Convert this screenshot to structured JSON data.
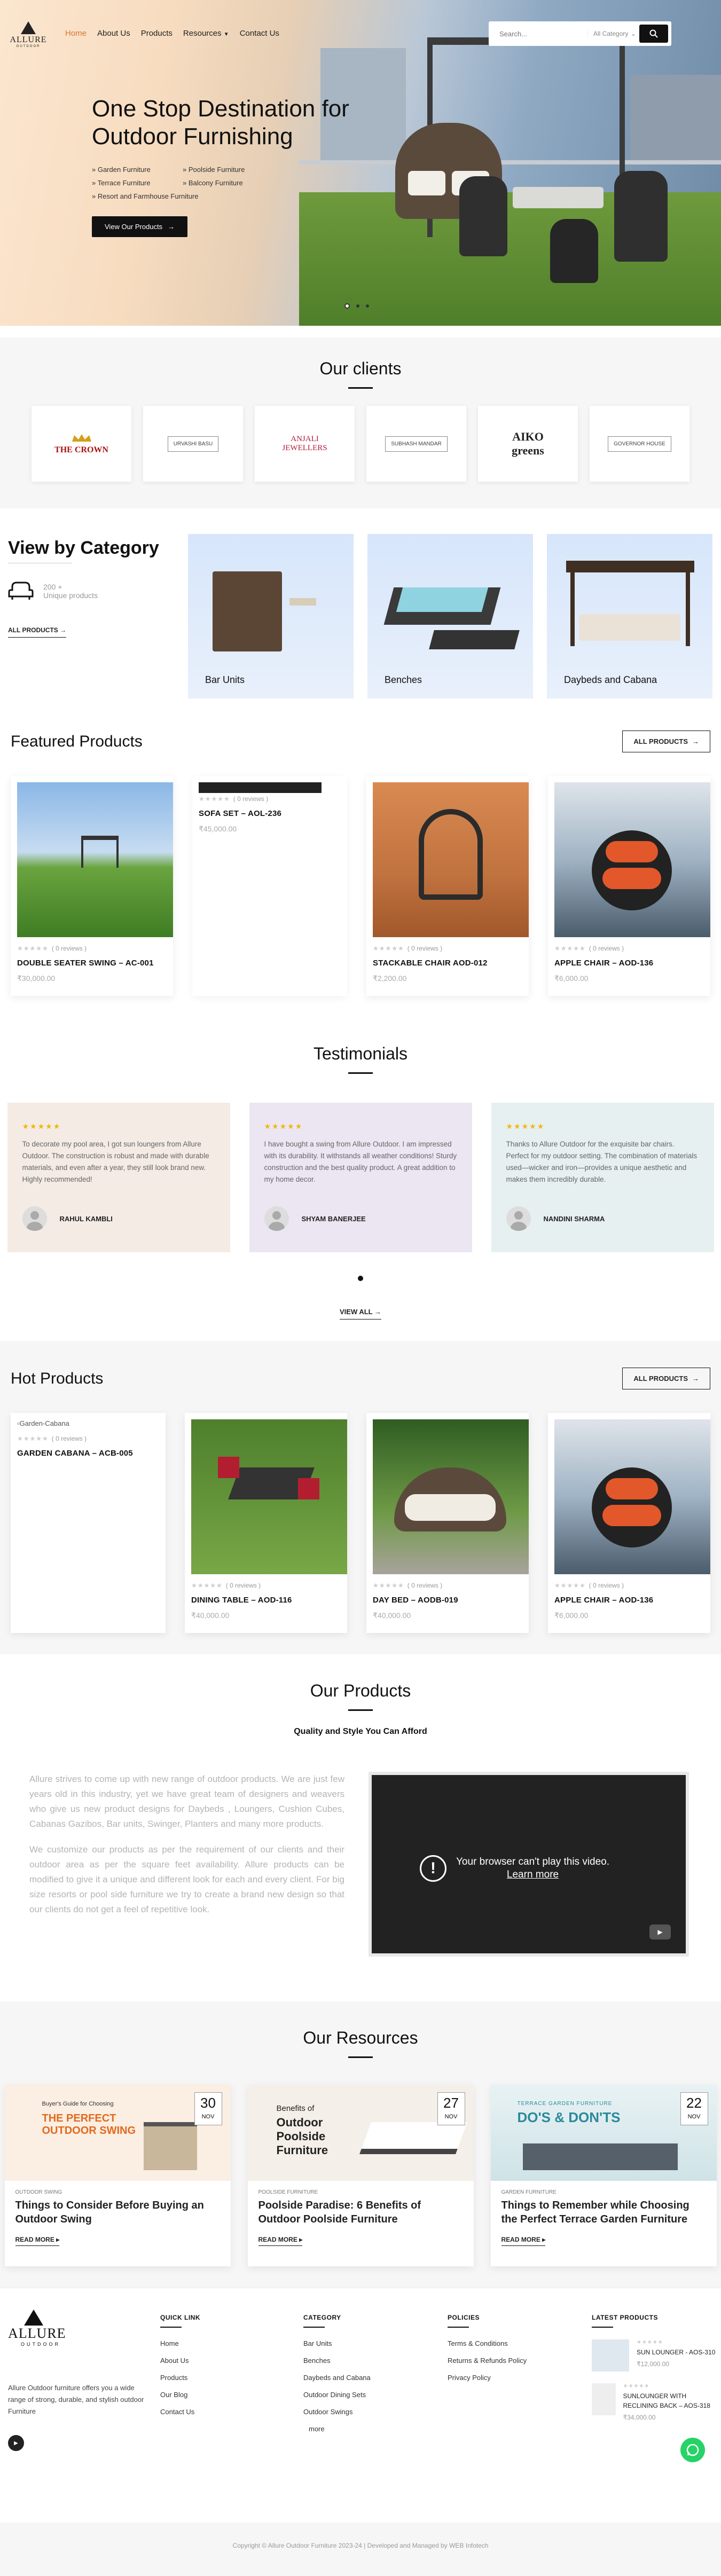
{
  "header": {
    "logo_text": "ALLURE",
    "logo_sub": "OUTDOOR",
    "menu": [
      {
        "label": "Home"
      },
      {
        "label": "About Us"
      },
      {
        "label": "Products"
      },
      {
        "label": "Resources"
      },
      {
        "label": "Contact Us"
      }
    ],
    "search_placeholder": "Search...",
    "category_select": "All Category"
  },
  "hero": {
    "title": "One Stop Destination for Outdoor Furnishing",
    "links": [
      "Garden Furniture",
      "Poolside Furniture",
      "Terrace Furniture",
      "Balcony Furniture",
      "Resort and Farmhouse Furniture"
    ],
    "button": "View Our Products"
  },
  "clients": {
    "title": "Our clients",
    "logos": [
      "THE CROWN",
      "URVASHI BASU",
      "ANJALI JEWELLERS",
      "SUBHASH MANDAR",
      "AIKO greens",
      "GOVERNOR HOUSE"
    ]
  },
  "categories": {
    "title": "View by Category",
    "count_line1": "200 +",
    "count_line2": "Unique products",
    "all_link": "ALL PRODUCTS",
    "items": [
      {
        "name": "Bar Units"
      },
      {
        "name": "Benches"
      },
      {
        "name": "Daybeds and Cabana"
      }
    ]
  },
  "featured": {
    "title": "Featured Products",
    "button": "ALL PRODUCTS",
    "products": [
      {
        "name": "DOUBLE SEATER SWING – AC-001",
        "reviews": "( 0 reviews )",
        "price": "₹30,000.00"
      },
      {
        "name": "SOFA SET – AOL-236",
        "reviews": "( 0 reviews )",
        "price": "₹45,000.00"
      },
      {
        "name": "STACKABLE CHAIR AOD-012",
        "reviews": "( 0 reviews )",
        "price": "₹2,200.00"
      },
      {
        "name": "APPLE CHAIR – AOD-136",
        "reviews": "( 0 reviews )",
        "price": "₹6,000.00"
      }
    ]
  },
  "testimonials": {
    "title": "Testimonials",
    "view_all": "VIEW ALL",
    "items": [
      {
        "text": "To decorate my pool area, I got sun loungers from Allure Outdoor. The construction is robust and made with durable materials, and even after a year, they still look brand new. Highly recommended!",
        "author": "RAHUL KAMBLI",
        "bg": "#f3ebe4"
      },
      {
        "text": "I have bought a swing from Allure Outdoor. I am impressed with its durability. It withstands all weather conditions! Sturdy construction and the best quality product. A great addition to my home decor.",
        "author": "SHYAM BANERJEE",
        "bg": "#ebe6f2"
      },
      {
        "text": "Thanks to Allure Outdoor for the exquisite bar chairs. Perfect for my outdoor setting. The combination of materials used—wicker and iron—provides a unique aesthetic and makes them incredibly durable.",
        "author": "NANDINI SHARMA",
        "bg": "#e6f0f0"
      }
    ]
  },
  "hot": {
    "title": "Hot Products",
    "button": "ALL PRODUCTS",
    "products": [
      {
        "name": "GARDEN CABANA – ACB-005",
        "reviews": "( 0 reviews )",
        "price": "",
        "alt": "Garden-Cabana"
      },
      {
        "name": "DINING TABLE – AOD-116",
        "reviews": "( 0 reviews )",
        "price": "₹40,000.00"
      },
      {
        "name": "DAY BED – AODB-019",
        "reviews": "( 0 reviews )",
        "price": "₹40,000.00"
      },
      {
        "name": "APPLE CHAIR – AOD-136",
        "reviews": "( 0 reviews )",
        "price": "₹6,000.00"
      }
    ]
  },
  "our_products": {
    "title": "Our Products",
    "subtitle": "Quality and Style You Can Afford",
    "p1": "Allure strives to come up with new range of outdoor products. We are just few years old in this industry, yet we have great team of designers and weavers who give us new product designs for Daybeds , Loungers, Cushion Cubes, Cabanas Gazibos, Bar units, Swinger, Planters and many more products.",
    "p2": "We customize our products as per the requirement of our clients and their outdoor area as per the square feet availability. Allure products can be modified to give it a unique and different look for each and every client. For big size resorts or pool side furniture we try to create a brand new design so that our clients do not get a feel of repetitive look.",
    "video_msg": "Your browser can't play this video.",
    "video_link": "Learn more"
  },
  "resources": {
    "title": "Our Resources",
    "posts": [
      {
        "day": "30",
        "month": "NOV",
        "category": "OUTDOOR SWING",
        "title": "Things to Consider Before Buying an Outdoor Swing",
        "more": "READ MORE",
        "img_top": "Buyer's Guide for Choosing",
        "img_big": "THE PERFECT OUTDOOR SWING"
      },
      {
        "day": "27",
        "month": "NOV",
        "category": "POOLSIDE FURNITURE",
        "title": "Poolside Paradise: 6 Benefits of Outdoor Poolside Furniture",
        "more": "READ MORE",
        "img_top": "Benefits of",
        "img_big": "Outdoor Poolside Furniture"
      },
      {
        "day": "22",
        "month": "NOV",
        "category": "GARDEN FURNITURE",
        "title": "Things to Remember while Choosing the Perfect Terrace Garden Furniture",
        "more": "READ MORE",
        "img_top": "TERRACE GARDEN FURNITURE",
        "img_big": "DO'S & DON'TS"
      }
    ]
  },
  "footer": {
    "logo_text": "ALLURE",
    "logo_sub": "OUTDOOR",
    "description": "Allure Outdoor furniture offers you a wide range of strong, durable, and stylish outdoor Furniture",
    "quick_title": "QUICK LINK",
    "quick_links": [
      "Home",
      "About Us",
      "Products",
      "Our Blog",
      "Contact Us"
    ],
    "category_title": "CATEGORY",
    "category_links": [
      "Bar Units",
      "Benches",
      "Daybeds and Cabana",
      "Outdoor Dining Sets",
      "Outdoor Swings",
      "more"
    ],
    "policies_title": "POLICIES",
    "policy_links": [
      "Terms & Conditions",
      "Returns & Refunds Policy",
      "Privacy Policy"
    ],
    "latest_title": "LATEST PRODUCTS",
    "latest": [
      {
        "name": "SUN LOUNGER - AOS-310",
        "price": "₹12,000.00"
      },
      {
        "name": "SUNLOUNGER WITH RECLINING BACK – AOS-318",
        "price": "₹34,000.00"
      }
    ],
    "copyright": "Copyright © Allure Outdoor Furniture 2023-24 | Developed and Managed by WEB Infotech"
  }
}
